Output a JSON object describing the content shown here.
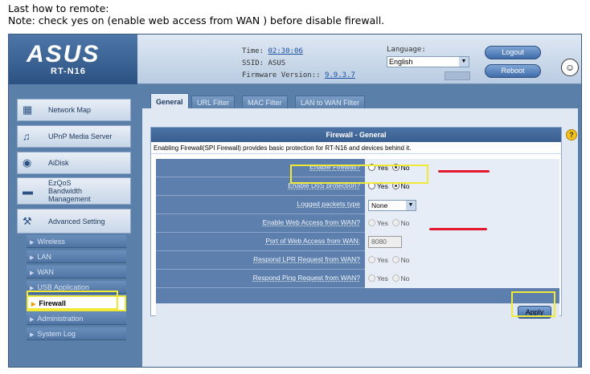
{
  "note": {
    "line1": "Last how to remote:",
    "line2": "Note: check yes on (enable web access from WAN ) before disable firewall."
  },
  "header": {
    "logo": "ASUS",
    "model": "RT-N16",
    "time_label": "Time:",
    "time_value": "02:30:06",
    "ssid_label": "SSID:",
    "ssid_value": "ASUS",
    "firmware_label": "Firmware Version::",
    "firmware_value": "9.9.3.7",
    "language_label": "Language:",
    "language_value": "English",
    "logout_label": "Logout",
    "reboot_label": "Reboot"
  },
  "sidebar": {
    "items": [
      {
        "label": "Network Map",
        "icon": "network-map-icon"
      },
      {
        "label": "UPnP Media Server",
        "icon": "media-server-icon"
      },
      {
        "label": "AiDisk",
        "icon": "aidisk-icon"
      },
      {
        "label": "EzQoS Bandwidth Management",
        "icon": "qos-icon"
      },
      {
        "label": "Advanced Setting",
        "icon": "advanced-setting-icon"
      }
    ],
    "sub_items": [
      {
        "label": "Wireless"
      },
      {
        "label": "LAN"
      },
      {
        "label": "WAN"
      },
      {
        "label": "USB Application"
      },
      {
        "label": "Firewall"
      },
      {
        "label": "Administration"
      },
      {
        "label": "System Log"
      }
    ]
  },
  "tabs": [
    {
      "label": "General"
    },
    {
      "label": "URL Filter"
    },
    {
      "label": "MAC Filter"
    },
    {
      "label": "LAN to WAN Filter"
    }
  ],
  "panel": {
    "title": "Firewall - General",
    "description": "Enabling Firewall(SPI Firewall) provides basic protection for RT-N16 and devices behind it.",
    "rows": [
      {
        "label": "Enable Firewall?",
        "yes": "Yes",
        "no": "No",
        "selected": "No"
      },
      {
        "label": "Enable DoS protection?",
        "yes": "Yes",
        "no": "No",
        "selected": "No"
      },
      {
        "label": "Logged packets type",
        "value": "None"
      },
      {
        "label": "Enable Web Access from WAN?",
        "yes": "Yes",
        "no": "No",
        "selected": "none"
      },
      {
        "label": "Port of Web Access from WAN:",
        "value": "8080"
      },
      {
        "label": "Respond LPR Request from WAN?",
        "yes": "Yes",
        "no": "No",
        "selected": "none"
      },
      {
        "label": "Respond Ping Request from WAN?",
        "yes": "Yes",
        "no": "No",
        "selected": "none"
      }
    ],
    "apply_label": "Apply"
  },
  "colors": {
    "highlight": "#f0e935",
    "annotation_red": "#e3172d",
    "brand_blue": "#2c5283"
  }
}
